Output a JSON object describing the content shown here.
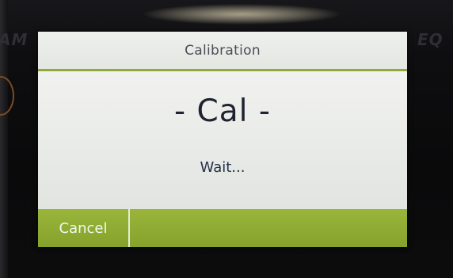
{
  "dialog": {
    "title": "Calibration",
    "status_main": "- Cal -",
    "status_sub": "Wait...",
    "cancel_label": "Cancel"
  },
  "background": {
    "left_label": "AM",
    "right_label": "EQ"
  },
  "colors": {
    "accent_green": "#8fa93b",
    "dialog_background": "#e9ebe8",
    "title_text": "#4a4e56",
    "body_text": "#1f2330"
  }
}
